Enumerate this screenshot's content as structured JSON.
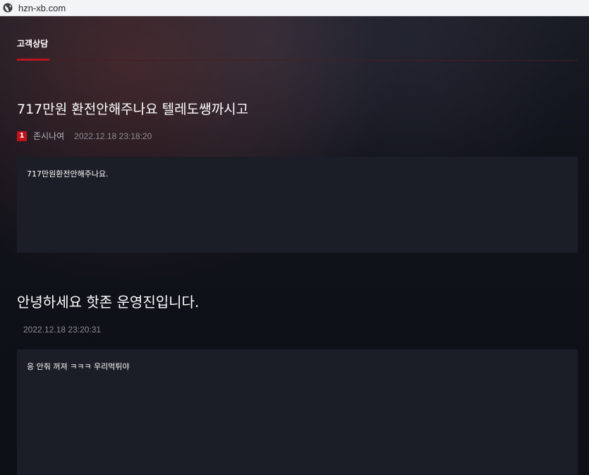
{
  "browser": {
    "url": "hzn-xb.com",
    "icon": "globe-icon"
  },
  "board": {
    "active_tab": "고객상담",
    "accent_color": "#b8151f"
  },
  "post": {
    "title": "717만원 환전안해주나요 텔레도쌩까시고",
    "author_level": "1",
    "author": "존시나여",
    "date": "2022.12.18 23:18:20",
    "body": "717만원환전안해주나요."
  },
  "reply": {
    "title": "안녕하세요 핫존 운영진입니다.",
    "date": "2022.12.18 23:20:31",
    "body": "응 안줘 꺼져 ㅋㅋㅋ 우리먹튀야"
  }
}
